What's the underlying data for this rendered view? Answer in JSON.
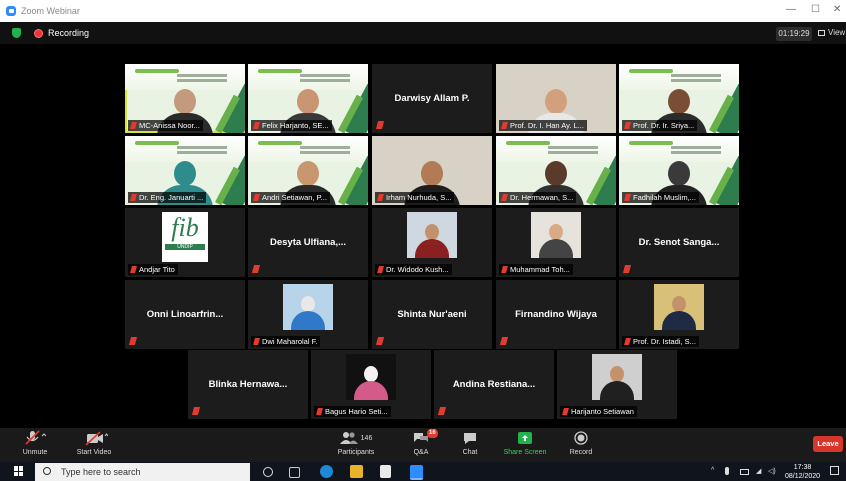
{
  "window": {
    "title": "Zoom Webinar",
    "minimize": "—",
    "maximize": "☐",
    "close": "✕"
  },
  "topbar": {
    "recording_label": "Recording",
    "timer": "01:19:29",
    "view_label": "View"
  },
  "participants": [
    {
      "name": "MC-Anissa Noor...",
      "type": "video-banner",
      "active": true,
      "skin": "#c49a7c",
      "cloth": "#2b2b2b"
    },
    {
      "name": "Felix Harjanto, SE...",
      "type": "video-banner",
      "skin": "#c99573",
      "cloth": "#3a3a3a"
    },
    {
      "name": "Darwisy Allam P.",
      "type": "name-only"
    },
    {
      "name": "Prof. Dr. I. Han Ay. L...",
      "type": "video-room",
      "skin": "#d2a07c",
      "cloth": "#e8e8e8"
    },
    {
      "name": "Prof. Dr. Ir. Sriya...",
      "type": "video-banner",
      "skin": "#7a4e36",
      "cloth": "#2c2c2c"
    },
    {
      "name": "Dr. Eng. Januarti ...",
      "type": "video-banner",
      "skin": "#2f8c8c",
      "cloth": "#2f8c8c"
    },
    {
      "name": "Andri Setiawan, P...",
      "type": "video-banner",
      "skin": "#c8966f",
      "cloth": "#2a2a2a"
    },
    {
      "name": "Irham Nurhuda, S...",
      "type": "video-room",
      "skin": "#b27a55",
      "cloth": "#1e1e1e"
    },
    {
      "name": "Dr. Hermawan, S...",
      "type": "video-banner",
      "skin": "#5a3a2a",
      "cloth": "#303030"
    },
    {
      "name": "Fadhilah Muslim,...",
      "type": "video-banner",
      "skin": "#3a3a3a",
      "cloth": "#222222"
    },
    {
      "name": "Andjar Tito",
      "type": "logo",
      "logo_text": "fib",
      "logo_sub": "UNDIP"
    },
    {
      "name": "Desyta Ulfiana,...",
      "type": "name-only"
    },
    {
      "name": "Dr. Widodo Kush...",
      "type": "photo",
      "skin": "#c4926a",
      "cloth": "#8a2020",
      "bg": "#cfd8e0"
    },
    {
      "name": "Muhammad Toh...",
      "type": "photo",
      "skin": "#d8aa86",
      "cloth": "#444444",
      "bg": "#e6e2dc"
    },
    {
      "name": "Dr. Senot Sanga...",
      "type": "name-only"
    },
    {
      "name": "Onni Linoarfrin...",
      "type": "name-only"
    },
    {
      "name": "Dwi Maharolal F.",
      "type": "photo",
      "skin": "#e8e8e8",
      "cloth": "#2f79c8",
      "bg": "#b8d4e8"
    },
    {
      "name": "Shinta Nur'aeni",
      "type": "name-only"
    },
    {
      "name": "Firnandino Wijaya",
      "type": "name-only"
    },
    {
      "name": "Prof. Dr. Istadi, S...",
      "type": "photo",
      "skin": "#c4926a",
      "cloth": "#1f2a44",
      "bg": "#d8c078"
    },
    {
      "name": "Blinka Hernawa...",
      "type": "name-only"
    },
    {
      "name": "Bagus Hario Seti...",
      "type": "photo",
      "skin": "#f2f2f2",
      "cloth": "#d45a8a",
      "bg": "#111111"
    },
    {
      "name": "Andina Restiana...",
      "type": "name-only"
    },
    {
      "name": "Harijanto Setiawan",
      "type": "photo",
      "skin": "#c4926a",
      "cloth": "#202020",
      "bg": "#cfcfcf"
    }
  ],
  "toolbar": {
    "unmute": "Unmute",
    "start_video": "Start Video",
    "participants_count": "146",
    "participants": "Participants",
    "qa": "Q&A",
    "qa_badge": "16",
    "chat": "Chat",
    "share_screen": "Share Screen",
    "record": "Record",
    "leave": "Leave"
  },
  "taskbar": {
    "search_placeholder": "Type here to search",
    "time": "17:38",
    "date": "08/12/2020"
  },
  "colors": {
    "accent": "#2d8cff",
    "active_speaker": "#d6e33a",
    "share_green": "#22b14c",
    "leave_red": "#d9362b"
  }
}
